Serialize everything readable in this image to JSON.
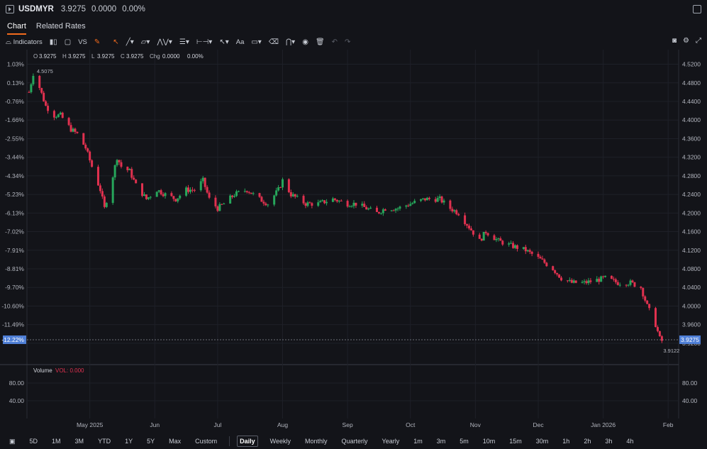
{
  "header": {
    "symbol": "USDMYR",
    "price": "3.9275",
    "change": "0.0000",
    "change_pct": "0.00%"
  },
  "tabs": [
    {
      "label": "Chart",
      "active": true
    },
    {
      "label": "Related Rates",
      "active": false
    }
  ],
  "toolbar": {
    "indicators_label": "Indicators",
    "compare_label": "VS",
    "text_tool_label": "Aa"
  },
  "legend": {
    "o_label": "O",
    "o_value": "3.9275",
    "h_label": "H",
    "h_value": "3.9275",
    "l_label": "L",
    "l_value": "3.9275",
    "c_label": "C",
    "c_value": "3.9275",
    "chg_label": "Chg",
    "chg_value": "0.0000",
    "chg_pct": "0.00%"
  },
  "volume": {
    "label": "Volume",
    "vol_text": "VOL: 0.000",
    "ticks": [
      "80.00",
      "40.00"
    ]
  },
  "colors": {
    "up": "#26a65b",
    "down": "#e0314f",
    "accent": "#f26b1d",
    "background": "#131419",
    "grid": "#1e2028"
  },
  "chart_data": {
    "type": "candlestick",
    "symbol": "USDMYR",
    "interval": "Daily",
    "ylim": [
      3.9,
      4.53
    ],
    "y_ticks": [
      "4.5200",
      "4.4800",
      "4.4400",
      "4.4000",
      "4.3600",
      "4.3200",
      "4.2800",
      "4.2400",
      "4.2000",
      "4.1600",
      "4.1200",
      "4.0800",
      "4.0400",
      "4.0000",
      "3.9600",
      "3.9200"
    ],
    "pct_ticks": [
      "1.03%",
      "0.13%",
      "-0.76%",
      "-1.66%",
      "-2.55%",
      "-3.44%",
      "-4.34%",
      "-5.23%",
      "-6.13%",
      "-7.02%",
      "-7.91%",
      "-8.81%",
      "-9.70%",
      "-10.60%",
      "-11.49%",
      "-12.22%"
    ],
    "x_ticks": [
      "May 2025",
      "Jun",
      "Jul",
      "Aug",
      "Sep",
      "Oct",
      "Nov",
      "Dec",
      "Jan 2026",
      "Feb"
    ],
    "last_price": "3.9275",
    "last_pct": "-12.22%",
    "high_label": "4.5075",
    "low_label": "3.9122",
    "approx_close_path": [
      [
        "2025-04-02",
        4.46
      ],
      [
        "2025-04-04",
        4.5
      ],
      [
        "2025-04-07",
        4.47
      ],
      [
        "2025-04-10",
        4.43
      ],
      [
        "2025-04-14",
        4.41
      ],
      [
        "2025-04-17",
        4.41
      ],
      [
        "2025-04-22",
        4.38
      ],
      [
        "2025-04-25",
        4.37
      ],
      [
        "2025-04-29",
        4.34
      ],
      [
        "2025-05-02",
        4.3
      ],
      [
        "2025-05-06",
        4.25
      ],
      [
        "2025-05-08",
        4.21
      ],
      [
        "2025-05-12",
        4.28
      ],
      [
        "2025-05-14",
        4.32
      ],
      [
        "2025-05-16",
        4.3
      ],
      [
        "2025-05-20",
        4.29
      ],
      [
        "2025-05-23",
        4.26
      ],
      [
        "2025-05-28",
        4.23
      ],
      [
        "2025-06-02",
        4.25
      ],
      [
        "2025-06-06",
        4.24
      ],
      [
        "2025-06-11",
        4.23
      ],
      [
        "2025-06-16",
        4.25
      ],
      [
        "2025-06-20",
        4.25
      ],
      [
        "2025-06-24",
        4.27
      ],
      [
        "2025-06-27",
        4.23
      ],
      [
        "2025-07-01",
        4.21
      ],
      [
        "2025-07-04",
        4.22
      ],
      [
        "2025-07-09",
        4.24
      ],
      [
        "2025-07-15",
        4.25
      ],
      [
        "2025-07-21",
        4.23
      ],
      [
        "2025-07-25",
        4.22
      ],
      [
        "2025-07-30",
        4.25
      ],
      [
        "2025-08-01",
        4.27
      ],
      [
        "2025-08-05",
        4.24
      ],
      [
        "2025-08-12",
        4.22
      ],
      [
        "2025-08-18",
        4.22
      ],
      [
        "2025-08-25",
        4.23
      ],
      [
        "2025-09-01",
        4.22
      ],
      [
        "2025-09-05",
        4.22
      ],
      [
        "2025-09-10",
        4.21
      ],
      [
        "2025-09-15",
        4.2
      ],
      [
        "2025-09-19",
        4.21
      ],
      [
        "2025-09-25",
        4.21
      ],
      [
        "2025-10-01",
        4.22
      ],
      [
        "2025-10-08",
        4.23
      ],
      [
        "2025-10-15",
        4.23
      ],
      [
        "2025-10-20",
        4.21
      ],
      [
        "2025-10-24",
        4.2
      ],
      [
        "2025-10-29",
        4.17
      ],
      [
        "2025-11-03",
        4.14
      ],
      [
        "2025-11-06",
        4.16
      ],
      [
        "2025-11-12",
        4.14
      ],
      [
        "2025-11-18",
        4.13
      ],
      [
        "2025-11-25",
        4.12
      ],
      [
        "2025-12-02",
        4.1
      ],
      [
        "2025-12-08",
        4.08
      ],
      [
        "2025-12-12",
        4.06
      ],
      [
        "2025-12-17",
        4.05
      ],
      [
        "2025-12-23",
        4.05
      ],
      [
        "2026-01-02",
        4.06
      ],
      [
        "2026-01-08",
        4.05
      ],
      [
        "2026-01-14",
        4.05
      ],
      [
        "2026-01-19",
        4.04
      ],
      [
        "2026-01-22",
        4.0
      ],
      [
        "2026-01-26",
        3.96
      ],
      [
        "2026-01-28",
        3.93
      ],
      [
        "2026-01-29",
        3.925
      ]
    ]
  },
  "footer": {
    "ranges": [
      "5D",
      "1M",
      "3M",
      "YTD",
      "1Y",
      "5Y",
      "Max",
      "Custom"
    ],
    "intervals": [
      {
        "label": "Daily",
        "active": true
      },
      {
        "label": "Weekly",
        "active": false
      },
      {
        "label": "Monthly",
        "active": false
      },
      {
        "label": "Quarterly",
        "active": false
      },
      {
        "label": "Yearly",
        "active": false
      },
      {
        "label": "1m",
        "active": false
      },
      {
        "label": "3m",
        "active": false
      },
      {
        "label": "5m",
        "active": false
      },
      {
        "label": "10m",
        "active": false
      },
      {
        "label": "15m",
        "active": false
      },
      {
        "label": "30m",
        "active": false
      },
      {
        "label": "1h",
        "active": false
      },
      {
        "label": "2h",
        "active": false
      },
      {
        "label": "3h",
        "active": false
      },
      {
        "label": "4h",
        "active": false
      }
    ]
  }
}
